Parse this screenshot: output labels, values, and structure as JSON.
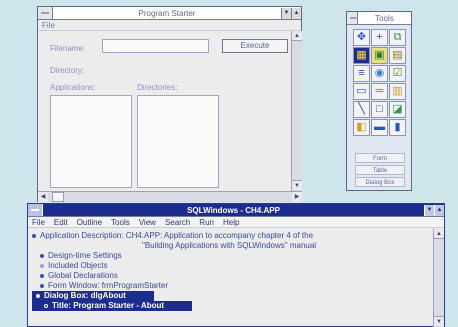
{
  "program_starter": {
    "title": "Program Starter",
    "menu": [
      "File"
    ],
    "filename_label": "Filename:",
    "execute_label": "Execute",
    "directory_label": "Directory:",
    "applications_label": "Applications:",
    "directories_label": "Directories:"
  },
  "tools": {
    "title": "Tools",
    "links": [
      "Form",
      "Table",
      "Dialog Box"
    ]
  },
  "sqlwindows": {
    "title": "SQLWindows - CH4.APP",
    "menu": [
      "File",
      "Edit",
      "Outline",
      "Tools",
      "View",
      "Search",
      "Run",
      "Help"
    ],
    "outline": [
      "Application Description: CH4.APP: Application to accompany chapter 4 of the",
      "\"Building Applications with SQLWindows\" manual",
      "Design-time Settings",
      "Included Objects",
      "Global Declarations",
      "Form Window: frmProgramStarter",
      "Dialog Box: dlgAbout",
      "Title: Program Starter - About"
    ]
  },
  "colors": {
    "desktop": "#cfe5ec",
    "active_title": "#1c2c8f",
    "selection": "#1c2c8f"
  }
}
